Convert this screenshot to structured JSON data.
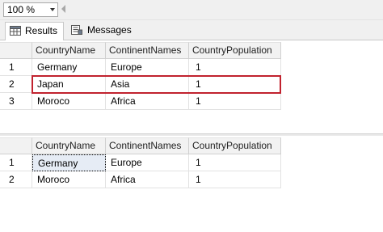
{
  "toolbar": {
    "zoom": "100 %"
  },
  "tabs": [
    {
      "label": "Results",
      "icon": "grid-icon"
    },
    {
      "label": "Messages",
      "icon": "messages-icon"
    }
  ],
  "colors": {
    "highlight": "#c1222e",
    "selected_cell": "#e6ecf5"
  },
  "grid1": {
    "columns": [
      "CountryName",
      "ContinentNames",
      "CountryPopulation"
    ],
    "rows": [
      {
        "num": "1",
        "country": "Germany",
        "continent": "Europe",
        "population": "1"
      },
      {
        "num": "2",
        "country": "Japan",
        "continent": "Asia",
        "population": "1"
      },
      {
        "num": "3",
        "country": "Moroco",
        "continent": "Africa",
        "population": "1"
      }
    ]
  },
  "grid2": {
    "columns": [
      "CountryName",
      "ContinentNames",
      "CountryPopulation"
    ],
    "rows": [
      {
        "num": "1",
        "country": "Germany",
        "continent": "Europe",
        "population": "1"
      },
      {
        "num": "2",
        "country": "Moroco",
        "continent": "Africa",
        "population": "1"
      }
    ]
  }
}
